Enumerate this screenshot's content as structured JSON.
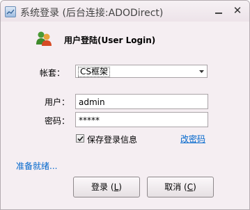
{
  "window": {
    "title": "系统登录 (后台连接:ADODirect)",
    "minimize_label": "_",
    "close_label": "✕"
  },
  "header": {
    "heading": "用户登陆(User Login)"
  },
  "form": {
    "account_label": "帐套：",
    "account_value": "CS框架",
    "user_label": "用户：",
    "user_value": "admin",
    "password_label": "密码：",
    "password_value": "*****",
    "remember_label": "保存登录信息",
    "remember_checked": true,
    "change_password_link": "改密码"
  },
  "status": {
    "text": "准备就绪..."
  },
  "buttons": {
    "ok_label": "登录",
    "ok_open": " (",
    "ok_key": "L",
    "ok_close": ")",
    "cancel_label": "取消",
    "cancel_open": " (",
    "cancel_key": "C",
    "cancel_close": ")"
  },
  "icons": {
    "app": "app-window-icon",
    "users": "users-icon",
    "dropdown": "chevron-down-icon",
    "check": "check-icon"
  },
  "colors": {
    "link": "#0066cc",
    "window_bg": "#f5eef2"
  }
}
